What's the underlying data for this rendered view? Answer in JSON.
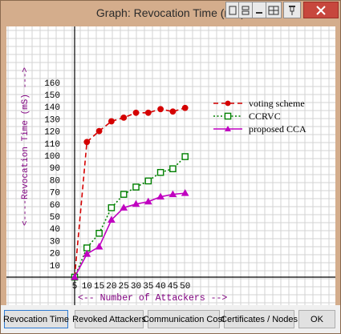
{
  "window": {
    "title": "Graph: Revocation Time (mS)",
    "accent": "#d4ad8c"
  },
  "buttons": [
    {
      "label": "Revocation Time",
      "active": true
    },
    {
      "label": "Revoked Attackers",
      "active": false
    },
    {
      "label": "Communication Cost",
      "active": false
    },
    {
      "label": "Certificates / Nodes",
      "active": false
    },
    {
      "label": "OK",
      "active": false
    }
  ],
  "chart_data": {
    "type": "line",
    "title": "",
    "xlabel": "<-- Number of Attackers -->",
    "ylabel": "<----Revocation Time (mS) --->",
    "categories": [
      "5",
      "10",
      "15",
      "20",
      "25",
      "30",
      "35",
      "40",
      "45",
      "50"
    ],
    "y_ticks": [
      10,
      20,
      30,
      40,
      50,
      60,
      70,
      80,
      90,
      100,
      110,
      120,
      130,
      140,
      150,
      160
    ],
    "ylim": [
      0,
      180
    ],
    "grid": true,
    "legend": "top-right",
    "series": [
      {
        "name": "voting scheme",
        "color": "#d40000",
        "dash": "dashed",
        "marker": "circle",
        "values": [
          0,
          111,
          120,
          128,
          131,
          135,
          135,
          138,
          136,
          139
        ]
      },
      {
        "name": "CCRVC",
        "color": "#008000",
        "dash": "dotted",
        "marker": "square",
        "values": [
          0,
          24,
          36,
          57,
          68,
          74,
          79,
          86,
          89,
          99
        ]
      },
      {
        "name": "proposed CCA",
        "color": "#c000c0",
        "dash": "solid",
        "marker": "triangle",
        "values": [
          0,
          19,
          25,
          47,
          57,
          60,
          62,
          66,
          68,
          69
        ]
      }
    ]
  }
}
